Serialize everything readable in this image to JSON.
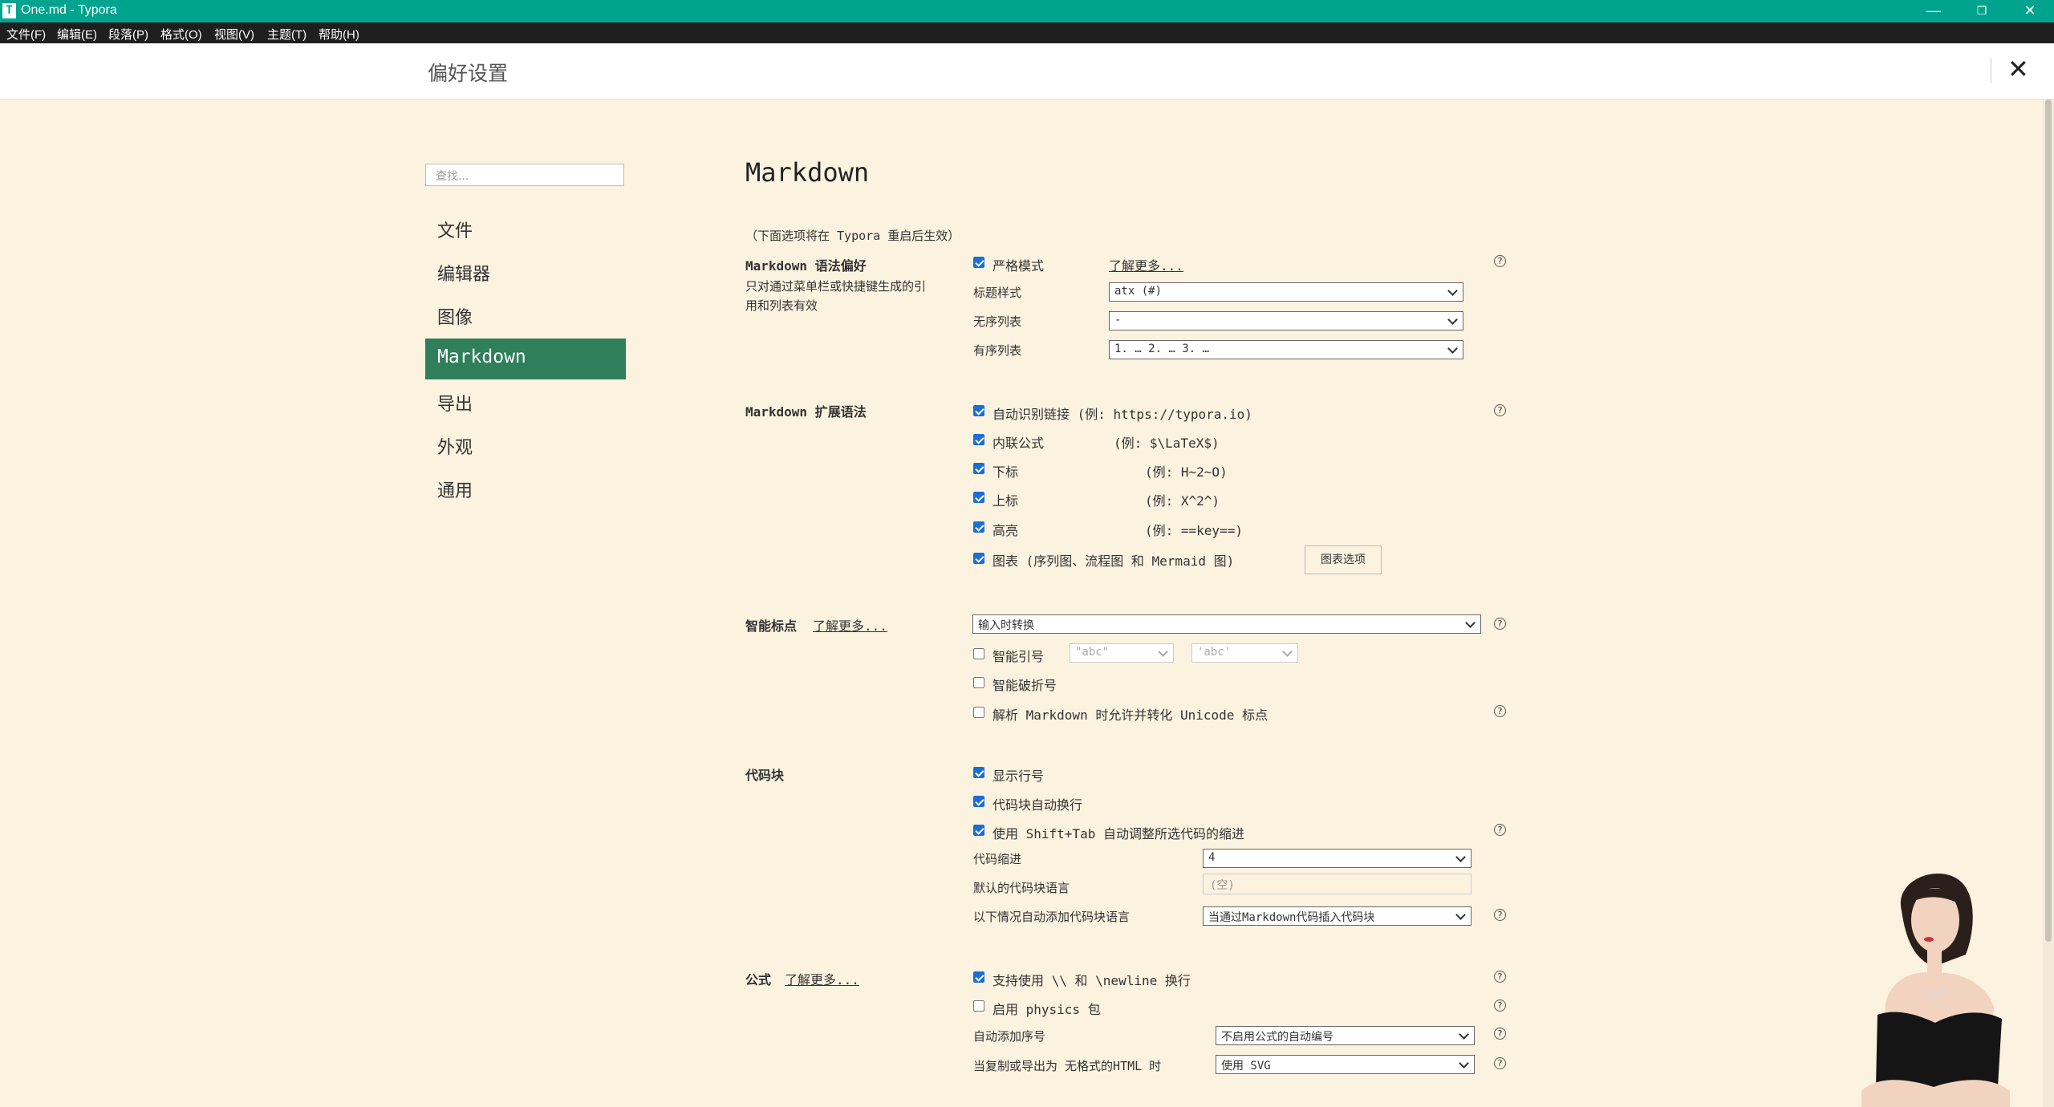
{
  "window": {
    "title": "One.md - Typora",
    "app_icon": "T"
  },
  "menu": [
    "文件(F)",
    "编辑(E)",
    "段落(P)",
    "格式(O)",
    "视图(V)",
    "主题(T)",
    "帮助(H)"
  ],
  "prefs": {
    "title": "偏好设置",
    "close": "✕"
  },
  "search": {
    "placeholder": "查找..."
  },
  "nav": [
    "文件",
    "编辑器",
    "图像",
    "Markdown",
    "导出",
    "外观",
    "通用"
  ],
  "content": {
    "heading": "Markdown",
    "restart_note": "（下面选项将在 Typora 重启后生效）",
    "syntax": {
      "title": "Markdown 语法偏好",
      "desc1": "只对通过菜单栏或快捷键生成的引",
      "desc2": "用和列表有效",
      "strict_label": "严格模式",
      "learn_more": "了解更多...",
      "heading_style_label": "标题样式",
      "heading_style_value": "atx (#)",
      "ul_label": "无序列表",
      "ul_value": "-",
      "ol_label": "有序列表",
      "ol_value": "1. … 2. … 3. …"
    },
    "ext": {
      "title": "Markdown 扩展语法",
      "autolink": "自动识别链接 (例: https://typora.io)",
      "inline_math": "内联公式",
      "inline_math_ex": "(例: $\\LaTeX$)",
      "subscript": "下标",
      "subscript_ex": "(例: H~2~O)",
      "superscript": "上标",
      "superscript_ex": "(例: X^2^)",
      "highlight": "高亮",
      "highlight_ex": "(例: ==key==)",
      "diagram": "图表 (序列图、流程图 和 Mermaid 图)",
      "diagram_btn": "图表选项"
    },
    "smart": {
      "title": "智能标点",
      "learn_more": "了解更多...",
      "mode": "输入时转换",
      "quotes": "智能引号",
      "quote_double": "\"abc\"",
      "quote_single": "'abc'",
      "dashes": "智能破折号",
      "unicode": "解析 Markdown 时允许并转化 Unicode 标点"
    },
    "code": {
      "title": "代码块",
      "line_numbers": "显示行号",
      "wrap": "代码块自动换行",
      "shift_tab": "使用 Shift+Tab 自动调整所选代码的缩进",
      "indent_label": "代码缩进",
      "indent_value": "4",
      "default_lang_label": "默认的代码块语言",
      "default_lang_value": "(空)",
      "auto_lang_label": "以下情况自动添加代码块语言",
      "auto_lang_value": "当通过Markdown代码插入代码块"
    },
    "math": {
      "title": "公式",
      "learn_more": "了解更多...",
      "newline": "支持使用 \\\\ 和 \\newline 换行",
      "physics": "启用 physics 包",
      "autonum_label": "自动添加序号",
      "autonum_value": "不启用公式的自动编号",
      "export_label": "当复制或导出为 无格式的HTML 时",
      "export_value": "使用 SVG"
    }
  }
}
